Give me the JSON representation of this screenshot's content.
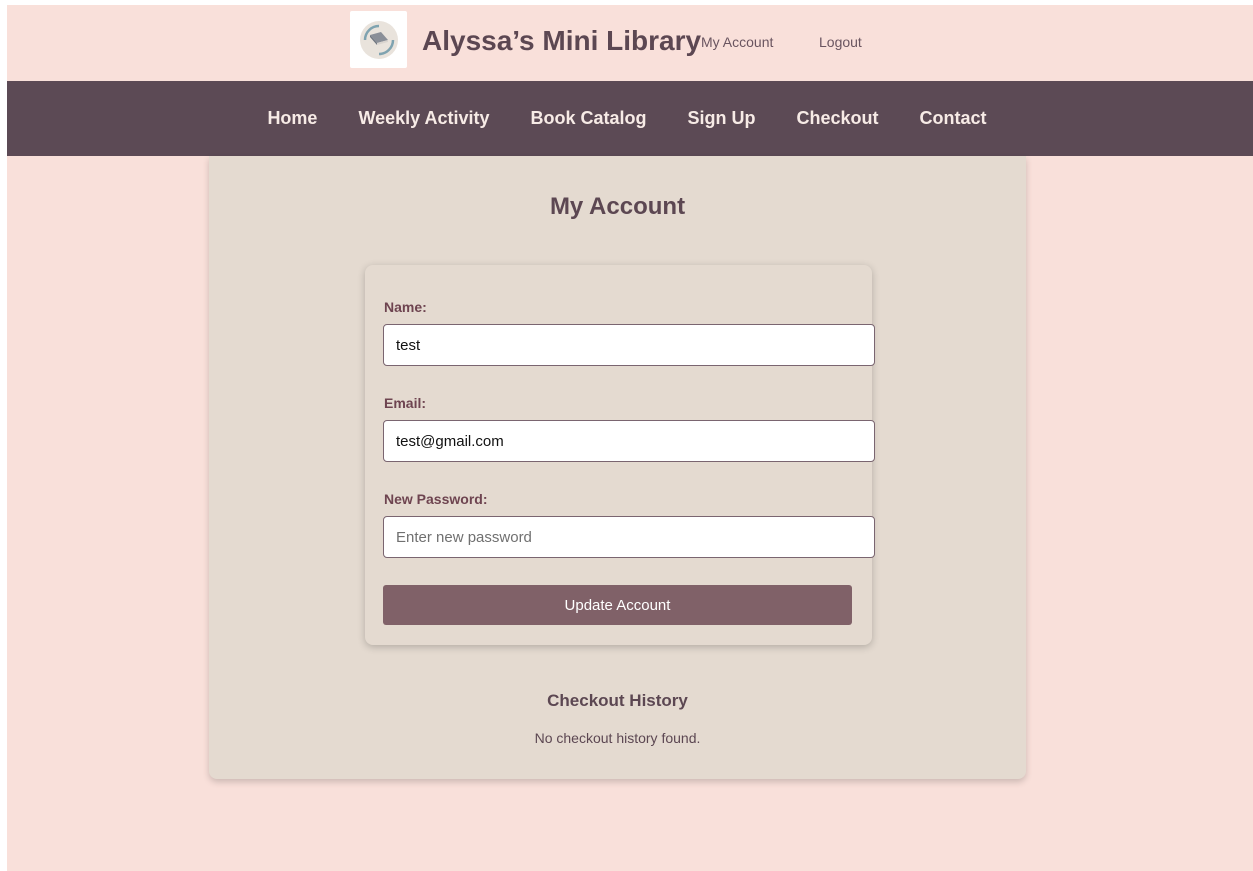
{
  "header": {
    "site_title": "Alyssa’s Mini Library",
    "links": {
      "my_account": "My Account",
      "logout": "Logout"
    }
  },
  "nav": {
    "items": [
      "Home",
      "Weekly Activity",
      "Book Catalog",
      "Sign Up",
      "Checkout",
      "Contact"
    ]
  },
  "main": {
    "title": "My Account",
    "form": {
      "name_label": "Name:",
      "name_value": "test",
      "email_label": "Email:",
      "email_value": "test@gmail.com",
      "password_label": "New Password:",
      "password_placeholder": "Enter new password",
      "submit_label": "Update Account"
    },
    "history": {
      "title": "Checkout History",
      "empty_message": "No checkout history found."
    }
  },
  "colors": {
    "page_background": "#f9e0da",
    "navbar": "#5c4a55",
    "card": "#e4dad0",
    "button": "#806168",
    "heading": "#5c4752"
  },
  "icons": {
    "logo": "book-logo-icon"
  }
}
